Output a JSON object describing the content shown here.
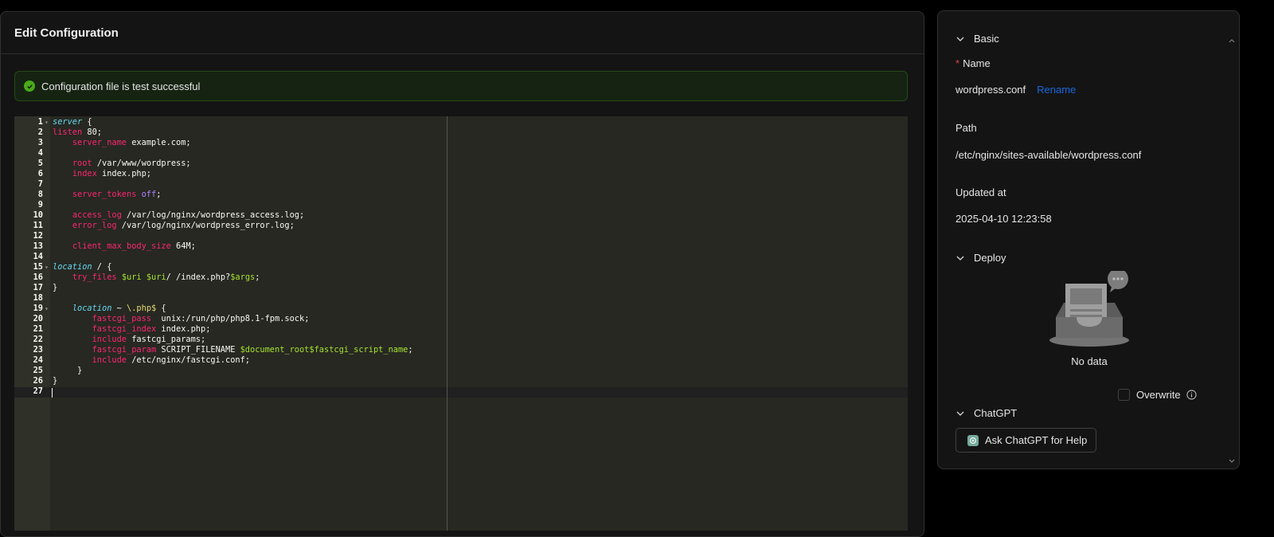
{
  "main": {
    "title": "Edit Configuration",
    "alert": {
      "text": "Configuration file is test successful",
      "status_color": "#49aa19"
    }
  },
  "editor": {
    "lines": [
      {
        "n": "1",
        "fold": true,
        "tokens": [
          {
            "t": "server",
            "c": "kw"
          },
          {
            "t": " {",
            "c": ""
          }
        ]
      },
      {
        "n": "2",
        "fold": false,
        "tokens": [
          {
            "t": "listen",
            "c": "dir"
          },
          {
            "t": " 80;",
            "c": ""
          }
        ]
      },
      {
        "n": "3",
        "fold": false,
        "tokens": [
          {
            "t": "    ",
            "c": ""
          },
          {
            "t": "server_name",
            "c": "dir"
          },
          {
            "t": " example.com;",
            "c": ""
          }
        ]
      },
      {
        "n": "4",
        "fold": false,
        "tokens": []
      },
      {
        "n": "5",
        "fold": false,
        "tokens": [
          {
            "t": "    ",
            "c": ""
          },
          {
            "t": "root",
            "c": "dir"
          },
          {
            "t": " /var/www/wordpress;",
            "c": ""
          }
        ]
      },
      {
        "n": "6",
        "fold": false,
        "tokens": [
          {
            "t": "    ",
            "c": ""
          },
          {
            "t": "index",
            "c": "dir"
          },
          {
            "t": " index.php;",
            "c": ""
          }
        ]
      },
      {
        "n": "7",
        "fold": false,
        "tokens": []
      },
      {
        "n": "8",
        "fold": false,
        "tokens": [
          {
            "t": "    ",
            "c": ""
          },
          {
            "t": "server_tokens",
            "c": "dir"
          },
          {
            "t": " ",
            "c": ""
          },
          {
            "t": "off",
            "c": "const"
          },
          {
            "t": ";",
            "c": ""
          }
        ]
      },
      {
        "n": "9",
        "fold": false,
        "tokens": []
      },
      {
        "n": "10",
        "fold": false,
        "tokens": [
          {
            "t": "    ",
            "c": ""
          },
          {
            "t": "access_log",
            "c": "dir"
          },
          {
            "t": " /var/log/nginx/wordpress_access.log;",
            "c": ""
          }
        ]
      },
      {
        "n": "11",
        "fold": false,
        "tokens": [
          {
            "t": "    ",
            "c": ""
          },
          {
            "t": "error_log",
            "c": "dir"
          },
          {
            "t": " /var/log/nginx/wordpress_error.log;",
            "c": ""
          }
        ]
      },
      {
        "n": "12",
        "fold": false,
        "tokens": []
      },
      {
        "n": "13",
        "fold": false,
        "tokens": [
          {
            "t": "    ",
            "c": ""
          },
          {
            "t": "client_max_body_size",
            "c": "dir"
          },
          {
            "t": " 64M;",
            "c": ""
          }
        ]
      },
      {
        "n": "14",
        "fold": false,
        "tokens": []
      },
      {
        "n": "15",
        "fold": true,
        "tokens": [
          {
            "t": "location",
            "c": "kw"
          },
          {
            "t": " / {",
            "c": ""
          }
        ]
      },
      {
        "n": "16",
        "fold": false,
        "tokens": [
          {
            "t": "    ",
            "c": ""
          },
          {
            "t": "try_files",
            "c": "dir"
          },
          {
            "t": " ",
            "c": ""
          },
          {
            "t": "$uri",
            "c": "var"
          },
          {
            "t": " ",
            "c": ""
          },
          {
            "t": "$uri",
            "c": "var"
          },
          {
            "t": "/ /index.php?",
            "c": ""
          },
          {
            "t": "$args",
            "c": "var"
          },
          {
            "t": ";",
            "c": ""
          }
        ]
      },
      {
        "n": "17",
        "fold": false,
        "tokens": [
          {
            "t": "}",
            "c": ""
          }
        ]
      },
      {
        "n": "18",
        "fold": false,
        "tokens": []
      },
      {
        "n": "19",
        "fold": true,
        "tokens": [
          {
            "t": "    ",
            "c": ""
          },
          {
            "t": "location",
            "c": "kw"
          },
          {
            "t": " ~ ",
            "c": ""
          },
          {
            "t": "\\.php$",
            "c": "re"
          },
          {
            "t": " {",
            "c": ""
          }
        ]
      },
      {
        "n": "20",
        "fold": false,
        "tokens": [
          {
            "t": "        ",
            "c": ""
          },
          {
            "t": "fastcgi_pass",
            "c": "dir"
          },
          {
            "t": "  unix:/run/php/php8.1-fpm.sock;",
            "c": ""
          }
        ]
      },
      {
        "n": "21",
        "fold": false,
        "tokens": [
          {
            "t": "        ",
            "c": ""
          },
          {
            "t": "fastcgi_index",
            "c": "dir"
          },
          {
            "t": " index.php;",
            "c": ""
          }
        ]
      },
      {
        "n": "22",
        "fold": false,
        "tokens": [
          {
            "t": "        ",
            "c": ""
          },
          {
            "t": "include",
            "c": "dir"
          },
          {
            "t": " fastcgi_params;",
            "c": ""
          }
        ]
      },
      {
        "n": "23",
        "fold": false,
        "tokens": [
          {
            "t": "        ",
            "c": ""
          },
          {
            "t": "fastcgi_param",
            "c": "dir"
          },
          {
            "t": " SCRIPT_FILENAME ",
            "c": ""
          },
          {
            "t": "$document_root",
            "c": "var"
          },
          {
            "t": "$fastcgi_script_name",
            "c": "var"
          },
          {
            "t": ";",
            "c": ""
          }
        ]
      },
      {
        "n": "24",
        "fold": false,
        "tokens": [
          {
            "t": "        ",
            "c": ""
          },
          {
            "t": "include",
            "c": "dir"
          },
          {
            "t": " /etc/nginx/fastcgi.conf;",
            "c": ""
          }
        ]
      },
      {
        "n": "25",
        "fold": false,
        "tokens": [
          {
            "t": "     }",
            "c": ""
          }
        ]
      },
      {
        "n": "26",
        "fold": false,
        "tokens": [
          {
            "t": "}",
            "c": ""
          }
        ]
      },
      {
        "n": "27",
        "fold": false,
        "tokens": []
      }
    ]
  },
  "sidebar": {
    "basic": {
      "header": "Basic",
      "name_label": "Name",
      "name_value": "wordpress.conf",
      "rename_label": "Rename",
      "path_label": "Path",
      "path_value": "/etc/nginx/sites-available/wordpress.conf",
      "updated_label": "Updated at",
      "updated_value": "2025-04-10 12:23:58"
    },
    "deploy": {
      "header": "Deploy",
      "empty_text": "No data",
      "overwrite_label": "Overwrite"
    },
    "chatgpt": {
      "header": "ChatGPT",
      "button_label": "Ask ChatGPT for Help"
    },
    "icons": [
      "chevron-down-icon",
      "check-circle-icon",
      "info-icon",
      "chatgpt-icon",
      "empty-inbox-icon"
    ]
  }
}
